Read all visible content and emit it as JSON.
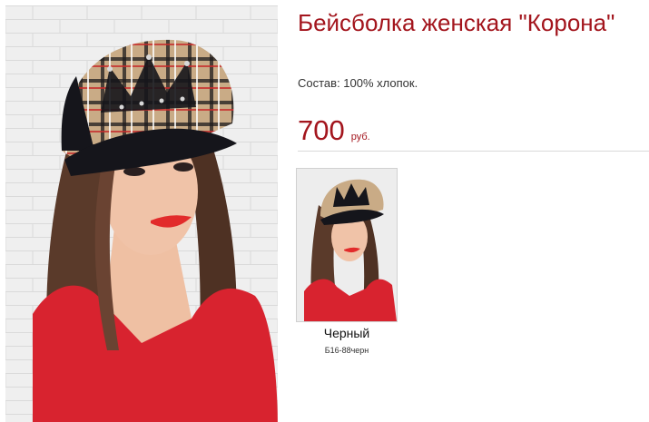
{
  "product": {
    "title": "Бейсболка женская \"Корона\"",
    "composition": "Состав: 100% хлопок.",
    "price": "700",
    "currency": "руб."
  },
  "variants": [
    {
      "name": "Черный",
      "sku": "Б16-88черн"
    }
  ],
  "colors": {
    "accent": "#a3151d",
    "text": "#333333",
    "divider": "#d9d9d9",
    "shirt": "#d8232f",
    "cap_plaid": "#c9ab86",
    "cap_black": "#15151b",
    "hair": "#5a3a2a",
    "skin": "#f0c3a8",
    "wall": "#ececec"
  }
}
